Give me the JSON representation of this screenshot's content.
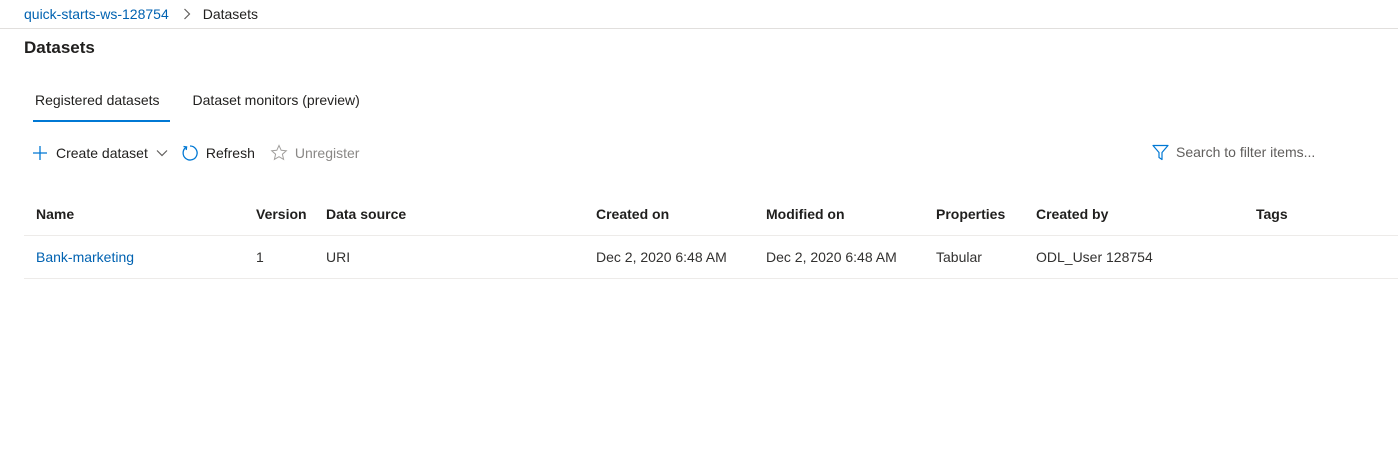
{
  "breadcrumb": {
    "workspace": "quick-starts-ws-128754",
    "current": "Datasets"
  },
  "page": {
    "title": "Datasets"
  },
  "tabs": [
    {
      "label": "Registered datasets",
      "active": true
    },
    {
      "label": "Dataset monitors (preview)",
      "active": false
    }
  ],
  "toolbar": {
    "create_label": "Create dataset",
    "refresh_label": "Refresh",
    "unregister_label": "Unregister"
  },
  "search": {
    "placeholder": "Search to filter items..."
  },
  "table": {
    "columns": [
      "Name",
      "Version",
      "Data source",
      "Created on",
      "Modified on",
      "Properties",
      "Created by",
      "Tags"
    ],
    "rows": [
      {
        "name": "Bank-marketing",
        "version": "1",
        "data_source": "URI",
        "created_on": "Dec 2, 2020 6:48 AM",
        "modified_on": "Dec 2, 2020 6:48 AM",
        "properties": "Tabular",
        "created_by": "ODL_User 128754",
        "tags": ""
      }
    ]
  },
  "colors": {
    "accent": "#0078d4",
    "link": "#0062b1",
    "disabled": "#8a8886",
    "divider": "#edebe9"
  }
}
